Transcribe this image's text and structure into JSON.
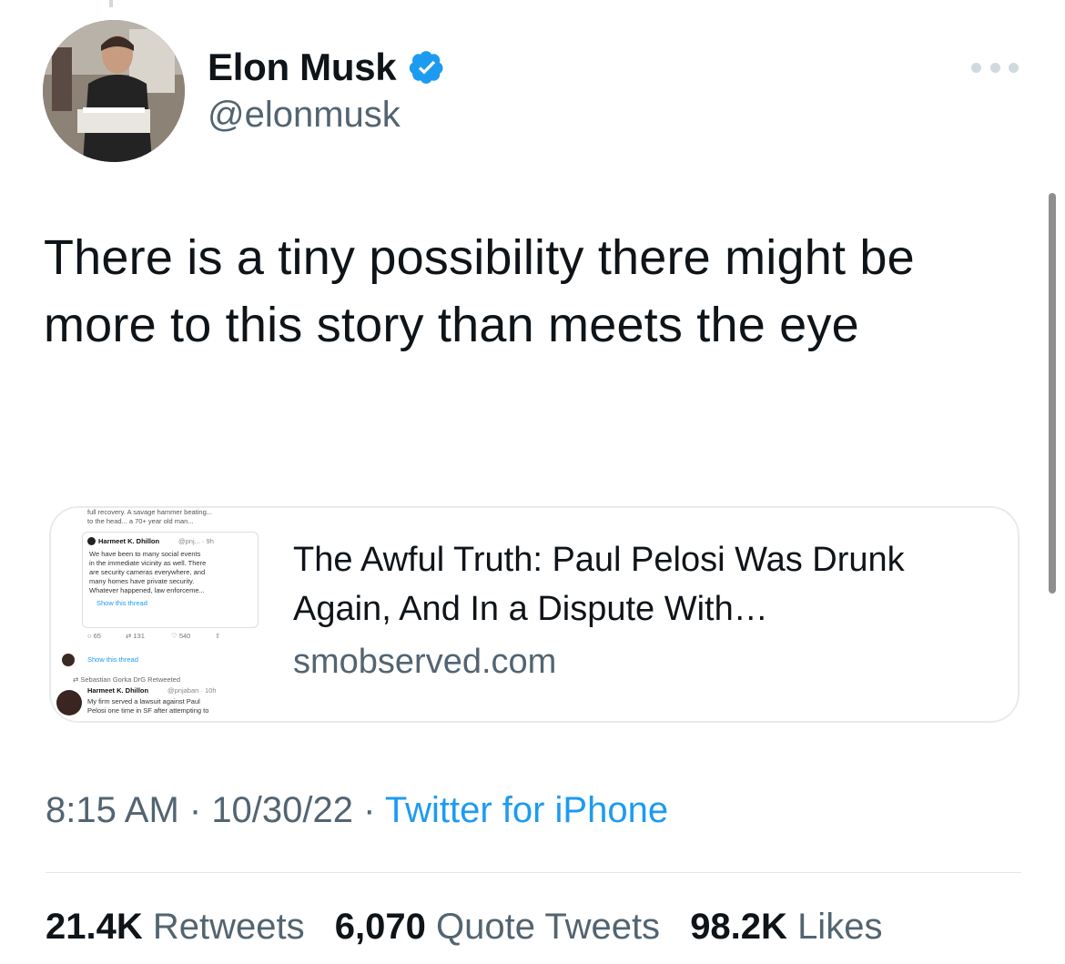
{
  "author": {
    "display_name": "Elon Musk",
    "handle": "@elonmusk",
    "verified": true,
    "avatar_icon": "profile-photo"
  },
  "tweet": {
    "text": "There is a tiny possibility there might be more to this story than meets the eye",
    "time": "8:15 AM",
    "date": "10/30/22",
    "source": "Twitter for iPhone"
  },
  "link_card": {
    "title": "The Awful Truth: Paul Pelosi Was Drunk Again, And In a Dispute With…",
    "domain": "smobserved.com",
    "thumbnail": {
      "top_line1": "full recovery. A savage hammer beating...",
      "top_line2": "to the head... a 70+ year old man...",
      "quote_author": "Harmeet K. Dhillon",
      "quote_handle": "@pnj... · 9h",
      "quote_lines": [
        "We have been to many social events",
        "in the immediate vicinity as well. There",
        "are security cameras everywhere, and",
        "many homes have private security.",
        "Whatever happened, law enforceme..."
      ],
      "show_thread_1": "Show this thread",
      "reply_count": "65",
      "retweet_count": "131",
      "like_count": "540",
      "show_thread_2": "Show this thread",
      "retweeted_by": "Sebastian Gorka DrG Retweeted",
      "second_author": "Harmeet K. Dhillon",
      "second_handle": "@pnjaban · 10h",
      "second_lines": [
        "My firm served a lawsuit against Paul",
        "Pelosi one time in SF after attempting to"
      ]
    }
  },
  "stats": {
    "retweets_count": "21.4K",
    "retweets_label": "Retweets",
    "quotes_count": "6,070",
    "quotes_label": "Quote Tweets",
    "likes_count": "98.2K",
    "likes_label": "Likes"
  },
  "colors": {
    "accent": "#1d9bf0",
    "secondary_text": "#536471",
    "primary_text": "#0f1419",
    "divider": "#e3e7ea"
  }
}
